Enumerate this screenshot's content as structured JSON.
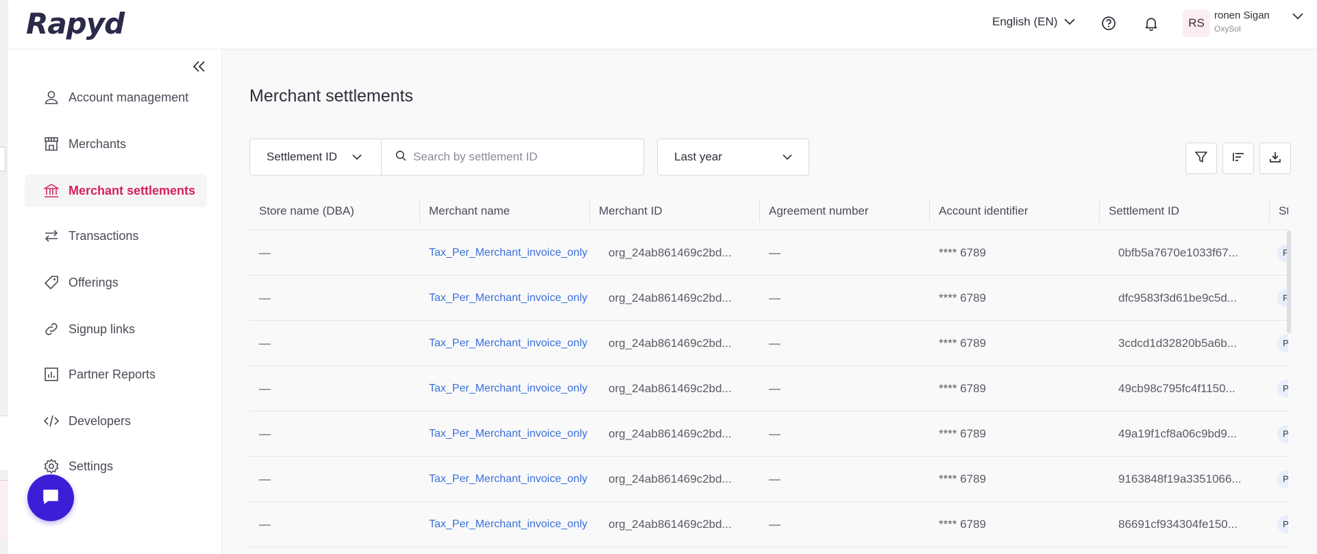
{
  "header": {
    "logo": "Rapyd",
    "language": "English (EN)",
    "user": {
      "initials": "RS",
      "name": "ronen Sigan",
      "org": "OxySol"
    }
  },
  "sidebar": {
    "items": [
      {
        "label": "Account management",
        "icon": "user-icon"
      },
      {
        "label": "Merchants",
        "icon": "store-icon"
      },
      {
        "label": "Merchant settlements",
        "icon": "bank-icon",
        "active": true
      },
      {
        "label": "Transactions",
        "icon": "arrows-icon"
      },
      {
        "label": "Offerings",
        "icon": "tag-icon"
      },
      {
        "label": "Signup links",
        "icon": "link-icon"
      },
      {
        "label": "Partner Reports",
        "icon": "chart-icon"
      },
      {
        "label": "Developers",
        "icon": "code-icon"
      },
      {
        "label": "Settings",
        "icon": "gear-icon"
      }
    ]
  },
  "main": {
    "title": "Merchant settlements",
    "search": {
      "field": "Settlement ID",
      "placeholder": "Search by settlement ID"
    },
    "date_range": "Last year"
  },
  "table": {
    "columns": [
      "Store name (DBA)",
      "Merchant name",
      "Merchant ID",
      "Agreement number",
      "Account identifier",
      "Settlement ID",
      "Sta"
    ],
    "rows": [
      {
        "store": "—",
        "merchant": "Tax_Per_Merchant_invoice_only",
        "merchant_id": "org_24ab861469c2bd...",
        "agreement": "—",
        "account": "**** 6789",
        "settlement": "0bfb5a7670e1033f67...",
        "status": "P"
      },
      {
        "store": "—",
        "merchant": "Tax_Per_Merchant_invoice_only",
        "merchant_id": "org_24ab861469c2bd...",
        "agreement": "—",
        "account": "**** 6789",
        "settlement": "dfc9583f3d61be9c5d...",
        "status": "P"
      },
      {
        "store": "—",
        "merchant": "Tax_Per_Merchant_invoice_only",
        "merchant_id": "org_24ab861469c2bd...",
        "agreement": "—",
        "account": "**** 6789",
        "settlement": "3cdcd1d32820b5a6b...",
        "status": "P"
      },
      {
        "store": "—",
        "merchant": "Tax_Per_Merchant_invoice_only",
        "merchant_id": "org_24ab861469c2bd...",
        "agreement": "—",
        "account": "**** 6789",
        "settlement": "49cb98c795fc4f1150...",
        "status": "P"
      },
      {
        "store": "—",
        "merchant": "Tax_Per_Merchant_invoice_only",
        "merchant_id": "org_24ab861469c2bd...",
        "agreement": "—",
        "account": "**** 6789",
        "settlement": "49a19f1cf8a06c9bd9...",
        "status": "P"
      },
      {
        "store": "—",
        "merchant": "Tax_Per_Merchant_invoice_only",
        "merchant_id": "org_24ab861469c2bd...",
        "agreement": "—",
        "account": "**** 6789",
        "settlement": "9163848f19a3351066...",
        "status": "P"
      },
      {
        "store": "—",
        "merchant": "Tax_Per_Merchant_invoice_only",
        "merchant_id": "org_24ab861469c2bd...",
        "agreement": "—",
        "account": "**** 6789",
        "settlement": "86691cf934304fe150...",
        "status": "P"
      }
    ]
  },
  "colors": {
    "accent": "#d4215f",
    "link": "#3a6fd8",
    "chat": "#3b1fd6"
  }
}
